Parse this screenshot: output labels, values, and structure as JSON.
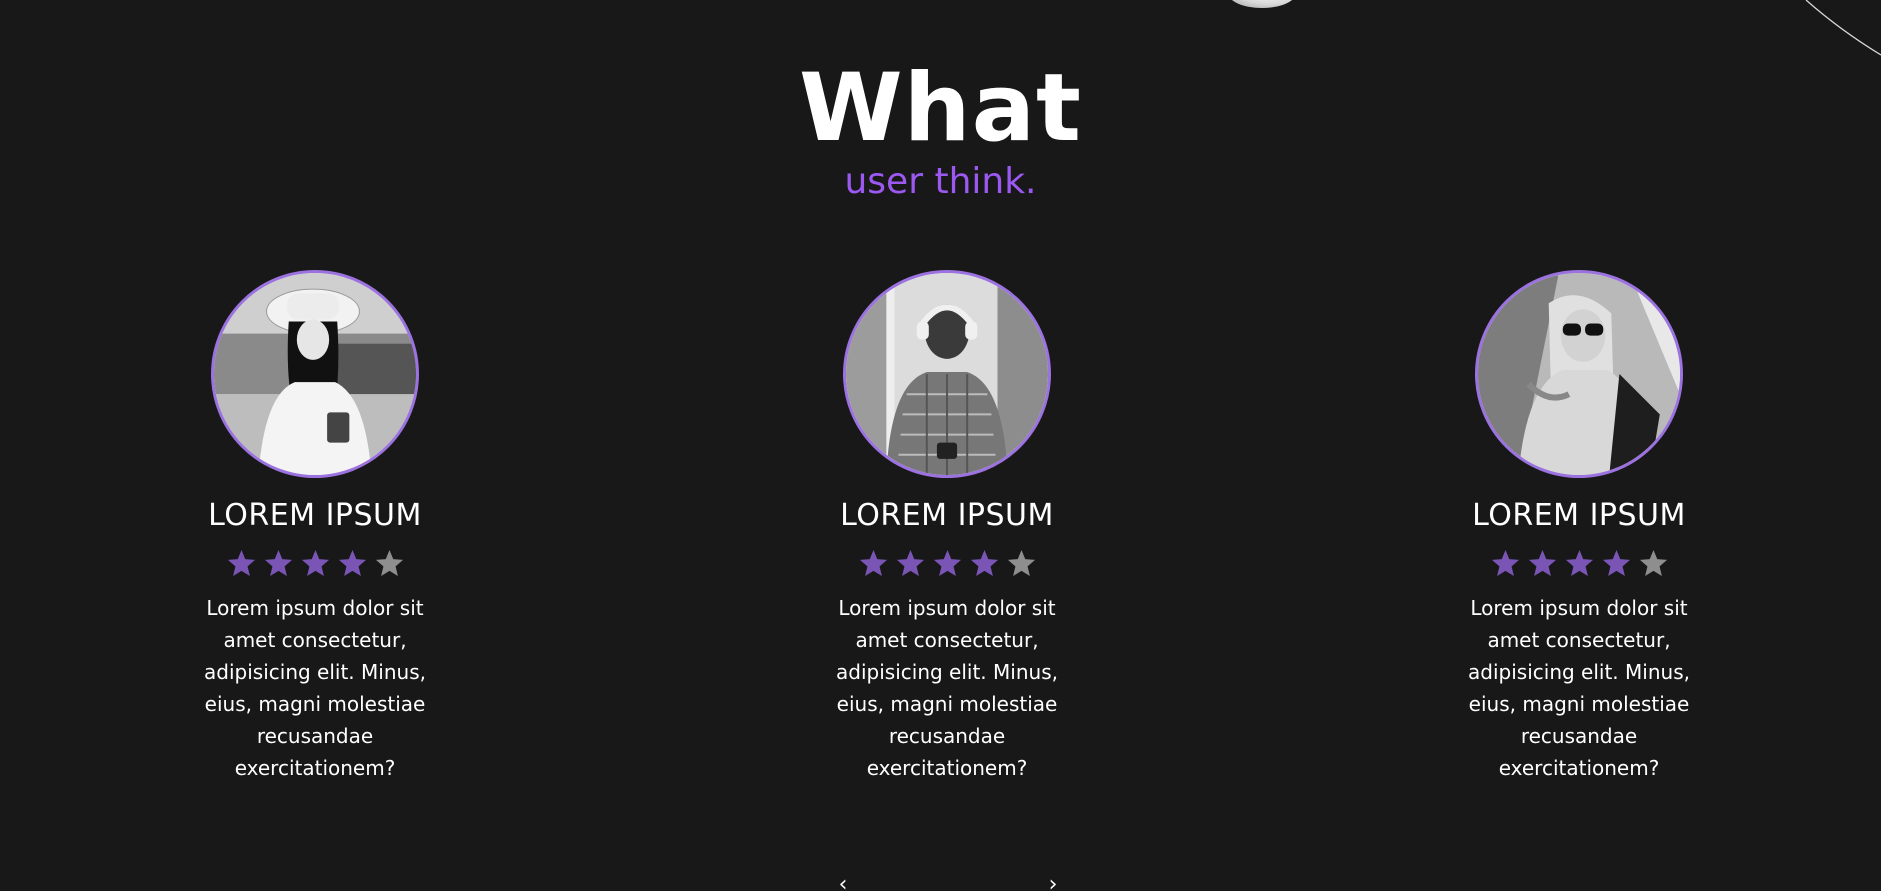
{
  "section": {
    "title": "What",
    "subtitle": "user think."
  },
  "colors": {
    "background": "#181819",
    "accent": "#9b59f2",
    "avatar_border": "#9b72e0",
    "star_filled": "#7a55b5",
    "star_empty": "#8e8e8e",
    "text": "#ffffff"
  },
  "testimonials": [
    {
      "name": "LOREM IPSUM",
      "rating": 4,
      "rating_max": 5,
      "text": "Lorem ipsum dolor sit amet consectetur, adipisicing elit. Minus, eius, magni molestiae recusandae exercitationem?",
      "avatar": "woman-hat-photo"
    },
    {
      "name": "LOREM IPSUM",
      "rating": 4,
      "rating_max": 5,
      "text": "Lorem ipsum dolor sit amet consectetur, adipisicing elit. Minus, eius, magni molestiae recusandae exercitationem?",
      "avatar": "man-headphones-photo"
    },
    {
      "name": "LOREM IPSUM",
      "rating": 4,
      "rating_max": 5,
      "text": "Lorem ipsum dolor sit amet consectetur, adipisicing elit. Minus, eius, magni molestiae recusandae exercitationem?",
      "avatar": "woman-sunglasses-photo"
    }
  ],
  "pager": {
    "prev_icon": "chevron-left-icon",
    "next_icon": "chevron-right-icon"
  }
}
